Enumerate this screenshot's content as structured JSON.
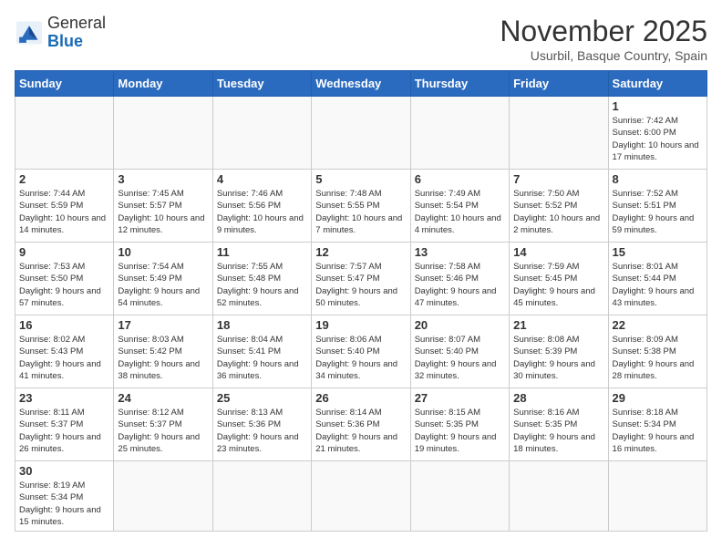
{
  "header": {
    "logo_text_general": "General",
    "logo_text_blue": "Blue",
    "month": "November 2025",
    "location": "Usurbil, Basque Country, Spain"
  },
  "days_of_week": [
    "Sunday",
    "Monday",
    "Tuesday",
    "Wednesday",
    "Thursday",
    "Friday",
    "Saturday"
  ],
  "weeks": [
    [
      {
        "day": "",
        "info": ""
      },
      {
        "day": "",
        "info": ""
      },
      {
        "day": "",
        "info": ""
      },
      {
        "day": "",
        "info": ""
      },
      {
        "day": "",
        "info": ""
      },
      {
        "day": "",
        "info": ""
      },
      {
        "day": "1",
        "info": "Sunrise: 7:42 AM\nSunset: 6:00 PM\nDaylight: 10 hours\nand 17 minutes."
      }
    ],
    [
      {
        "day": "2",
        "info": "Sunrise: 7:44 AM\nSunset: 5:59 PM\nDaylight: 10 hours\nand 14 minutes."
      },
      {
        "day": "3",
        "info": "Sunrise: 7:45 AM\nSunset: 5:57 PM\nDaylight: 10 hours\nand 12 minutes."
      },
      {
        "day": "4",
        "info": "Sunrise: 7:46 AM\nSunset: 5:56 PM\nDaylight: 10 hours\nand 9 minutes."
      },
      {
        "day": "5",
        "info": "Sunrise: 7:48 AM\nSunset: 5:55 PM\nDaylight: 10 hours\nand 7 minutes."
      },
      {
        "day": "6",
        "info": "Sunrise: 7:49 AM\nSunset: 5:54 PM\nDaylight: 10 hours\nand 4 minutes."
      },
      {
        "day": "7",
        "info": "Sunrise: 7:50 AM\nSunset: 5:52 PM\nDaylight: 10 hours\nand 2 minutes."
      },
      {
        "day": "8",
        "info": "Sunrise: 7:52 AM\nSunset: 5:51 PM\nDaylight: 9 hours\nand 59 minutes."
      }
    ],
    [
      {
        "day": "9",
        "info": "Sunrise: 7:53 AM\nSunset: 5:50 PM\nDaylight: 9 hours\nand 57 minutes."
      },
      {
        "day": "10",
        "info": "Sunrise: 7:54 AM\nSunset: 5:49 PM\nDaylight: 9 hours\nand 54 minutes."
      },
      {
        "day": "11",
        "info": "Sunrise: 7:55 AM\nSunset: 5:48 PM\nDaylight: 9 hours\nand 52 minutes."
      },
      {
        "day": "12",
        "info": "Sunrise: 7:57 AM\nSunset: 5:47 PM\nDaylight: 9 hours\nand 50 minutes."
      },
      {
        "day": "13",
        "info": "Sunrise: 7:58 AM\nSunset: 5:46 PM\nDaylight: 9 hours\nand 47 minutes."
      },
      {
        "day": "14",
        "info": "Sunrise: 7:59 AM\nSunset: 5:45 PM\nDaylight: 9 hours\nand 45 minutes."
      },
      {
        "day": "15",
        "info": "Sunrise: 8:01 AM\nSunset: 5:44 PM\nDaylight: 9 hours\nand 43 minutes."
      }
    ],
    [
      {
        "day": "16",
        "info": "Sunrise: 8:02 AM\nSunset: 5:43 PM\nDaylight: 9 hours\nand 41 minutes."
      },
      {
        "day": "17",
        "info": "Sunrise: 8:03 AM\nSunset: 5:42 PM\nDaylight: 9 hours\nand 38 minutes."
      },
      {
        "day": "18",
        "info": "Sunrise: 8:04 AM\nSunset: 5:41 PM\nDaylight: 9 hours\nand 36 minutes."
      },
      {
        "day": "19",
        "info": "Sunrise: 8:06 AM\nSunset: 5:40 PM\nDaylight: 9 hours\nand 34 minutes."
      },
      {
        "day": "20",
        "info": "Sunrise: 8:07 AM\nSunset: 5:40 PM\nDaylight: 9 hours\nand 32 minutes."
      },
      {
        "day": "21",
        "info": "Sunrise: 8:08 AM\nSunset: 5:39 PM\nDaylight: 9 hours\nand 30 minutes."
      },
      {
        "day": "22",
        "info": "Sunrise: 8:09 AM\nSunset: 5:38 PM\nDaylight: 9 hours\nand 28 minutes."
      }
    ],
    [
      {
        "day": "23",
        "info": "Sunrise: 8:11 AM\nSunset: 5:37 PM\nDaylight: 9 hours\nand 26 minutes."
      },
      {
        "day": "24",
        "info": "Sunrise: 8:12 AM\nSunset: 5:37 PM\nDaylight: 9 hours\nand 25 minutes."
      },
      {
        "day": "25",
        "info": "Sunrise: 8:13 AM\nSunset: 5:36 PM\nDaylight: 9 hours\nand 23 minutes."
      },
      {
        "day": "26",
        "info": "Sunrise: 8:14 AM\nSunset: 5:36 PM\nDaylight: 9 hours\nand 21 minutes."
      },
      {
        "day": "27",
        "info": "Sunrise: 8:15 AM\nSunset: 5:35 PM\nDaylight: 9 hours\nand 19 minutes."
      },
      {
        "day": "28",
        "info": "Sunrise: 8:16 AM\nSunset: 5:35 PM\nDaylight: 9 hours\nand 18 minutes."
      },
      {
        "day": "29",
        "info": "Sunrise: 8:18 AM\nSunset: 5:34 PM\nDaylight: 9 hours\nand 16 minutes."
      }
    ],
    [
      {
        "day": "30",
        "info": "Sunrise: 8:19 AM\nSunset: 5:34 PM\nDaylight: 9 hours\nand 15 minutes."
      },
      {
        "day": "",
        "info": ""
      },
      {
        "day": "",
        "info": ""
      },
      {
        "day": "",
        "info": ""
      },
      {
        "day": "",
        "info": ""
      },
      {
        "day": "",
        "info": ""
      },
      {
        "day": "",
        "info": ""
      }
    ]
  ]
}
